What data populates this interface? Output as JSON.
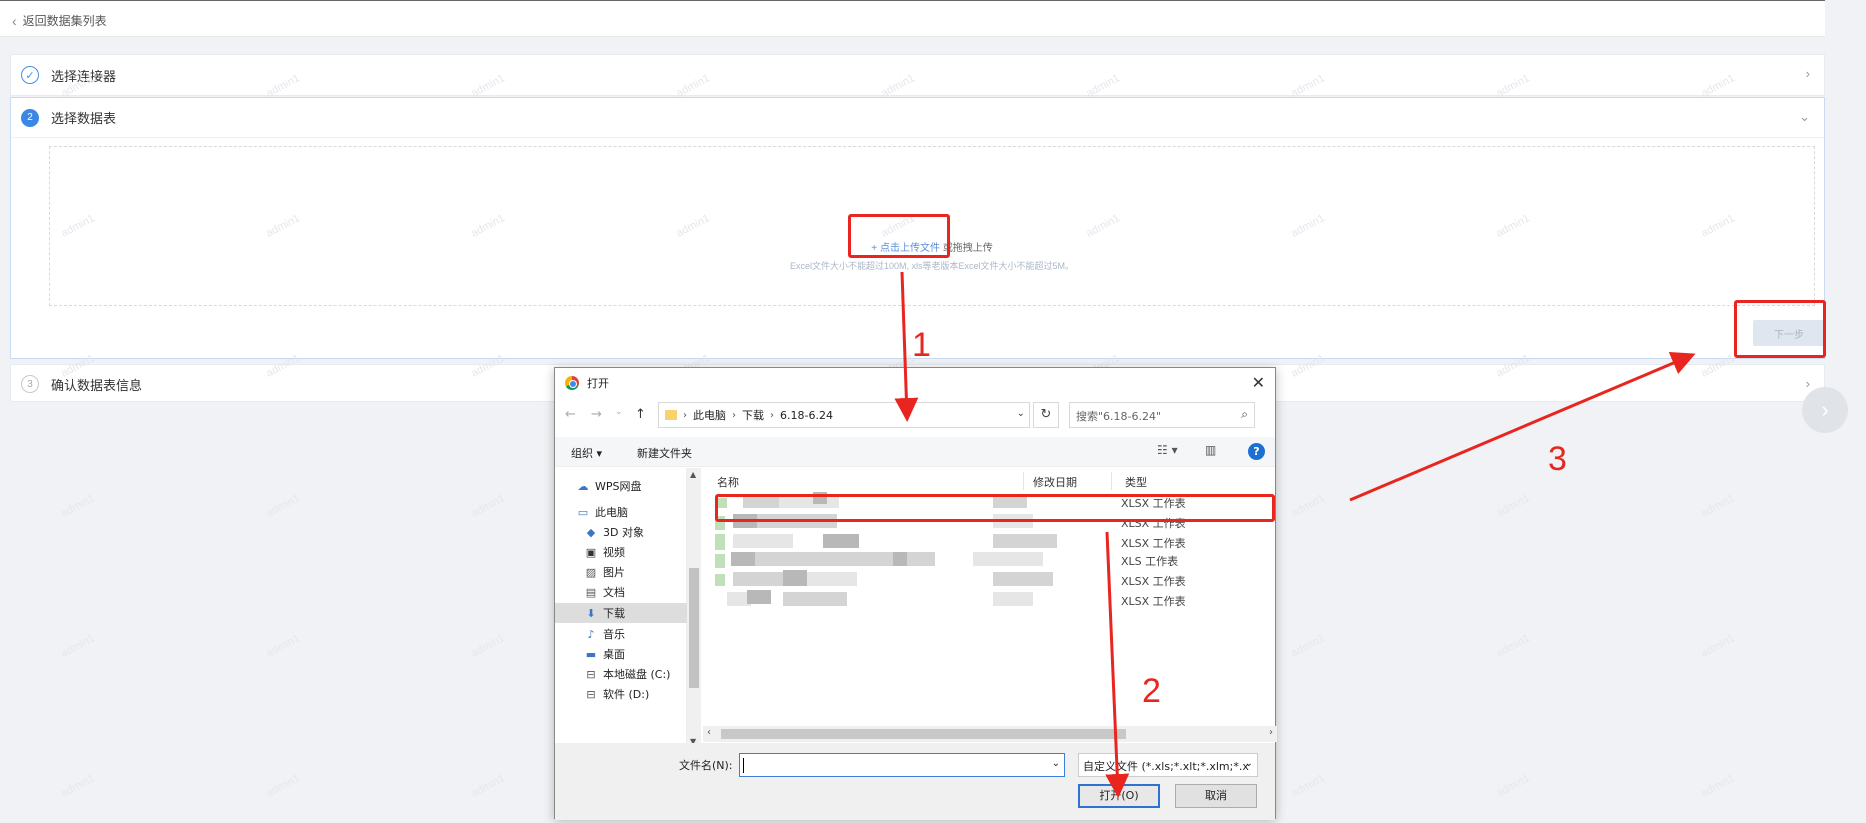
{
  "top": {
    "back_label": "返回数据集列表"
  },
  "steps": [
    {
      "num": "✓",
      "title": "选择连接器"
    },
    {
      "num": "2",
      "title": "选择数据表"
    },
    {
      "num": "3",
      "title": "确认数据表信息"
    }
  ],
  "upload": {
    "click_label": "点击上传文件",
    "drag_label": "或拖拽上传",
    "hint": "Excel文件大小不能超过100M, xls等老版本Excel文件大小不能超过5M。",
    "next_label": "下一步"
  },
  "watermark": "admin1",
  "annotations": {
    "n1": "1",
    "n2": "2",
    "n3": "3"
  },
  "dialog": {
    "title": "打开",
    "breadcrumb": [
      "此电脑",
      "下载",
      "6.18-6.24"
    ],
    "search_placeholder": "搜索\"6.18-6.24\"",
    "toolbar": {
      "organize": "组织 ▾",
      "new_folder": "新建文件夹"
    },
    "nav_items": [
      {
        "label": "WPS网盘",
        "icon": "cloud-icon"
      },
      {
        "label": "此电脑",
        "icon": "computer-icon"
      },
      {
        "label": "3D 对象",
        "icon": "cube-icon"
      },
      {
        "label": "视频",
        "icon": "video-icon"
      },
      {
        "label": "图片",
        "icon": "picture-icon"
      },
      {
        "label": "文档",
        "icon": "document-icon"
      },
      {
        "label": "下载",
        "icon": "download-icon"
      },
      {
        "label": "音乐",
        "icon": "music-icon"
      },
      {
        "label": "桌面",
        "icon": "desktop-icon"
      },
      {
        "label": "本地磁盘 (C:)",
        "icon": "drive-icon"
      },
      {
        "label": "软件 (D:)",
        "icon": "drive-icon"
      }
    ],
    "columns": {
      "name": "名称",
      "modified": "修改日期",
      "type": "类型"
    },
    "files": [
      {
        "type": "XLSX 工作表"
      },
      {
        "type": "XLSX 工作表"
      },
      {
        "type": "XLSX 工作表"
      },
      {
        "type": "XLS 工作表"
      },
      {
        "type": "XLSX 工作表"
      },
      {
        "type": "XLSX 工作表"
      }
    ],
    "filename_label": "文件名(N):",
    "filename_value": "",
    "filter": "自定义文件 (*.xls;*.xlt;*.xlm;*.x",
    "open_label": "打开(O)",
    "cancel_label": "取消"
  }
}
